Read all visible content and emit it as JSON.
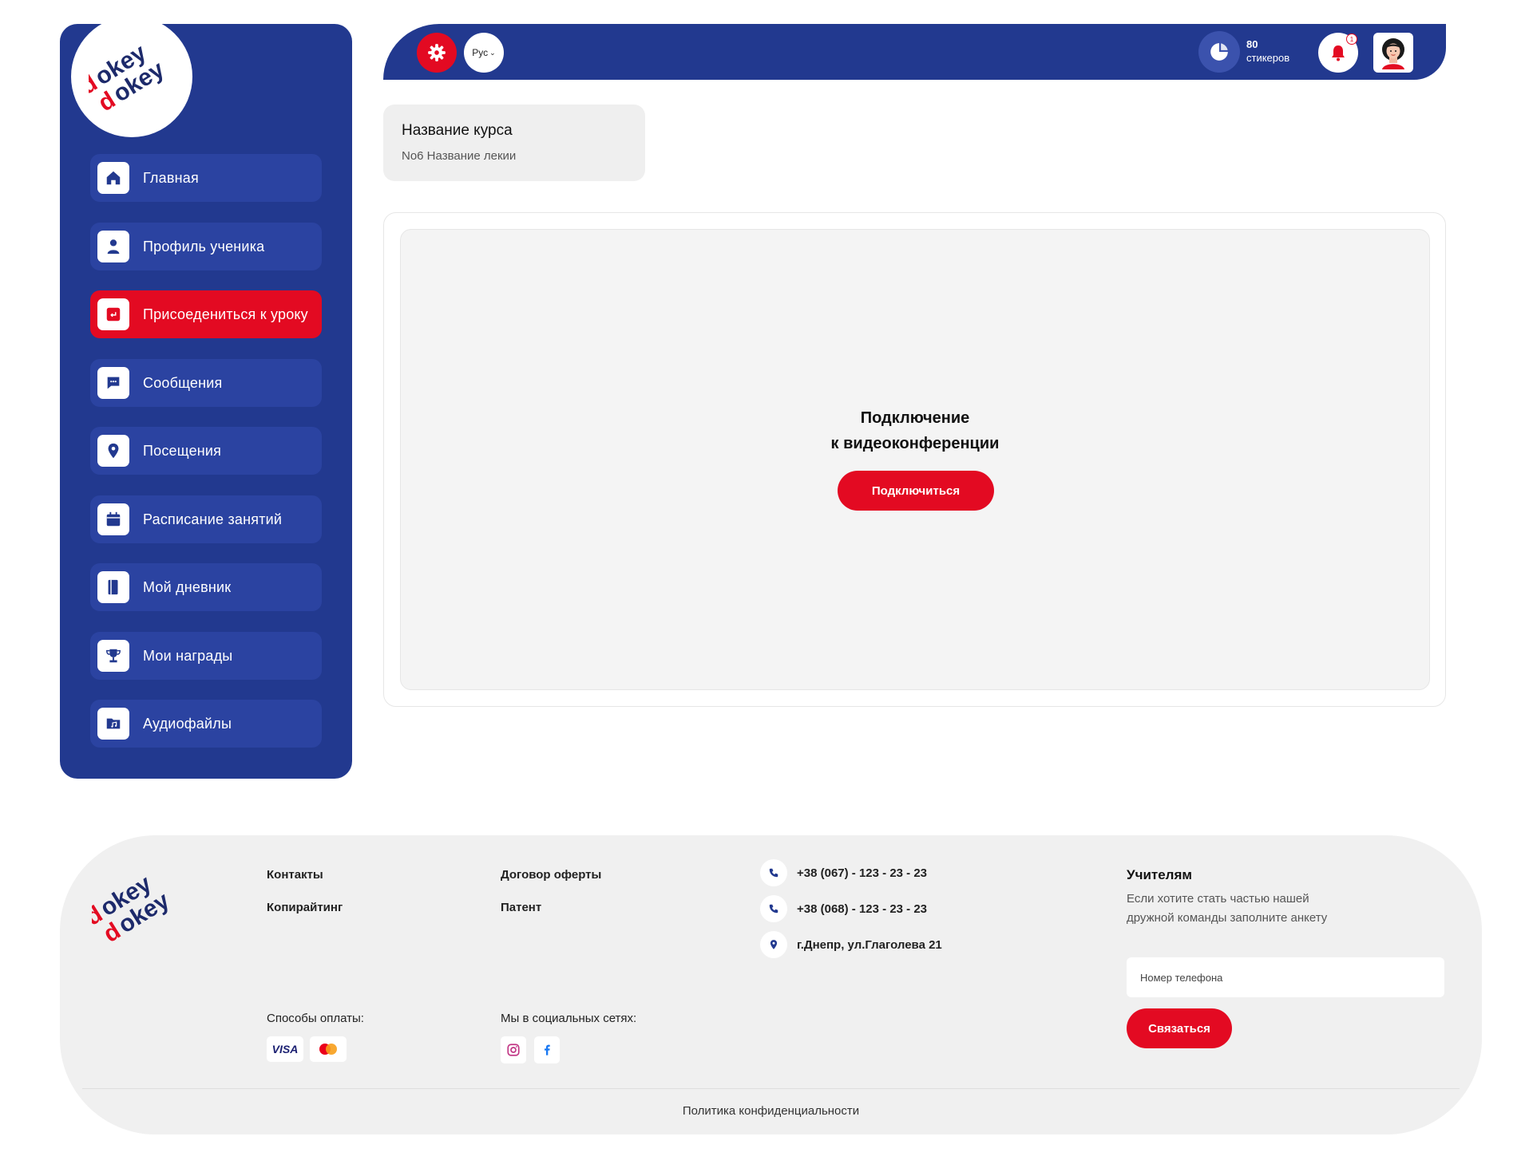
{
  "brand": {
    "logo_word_top": "okey",
    "logo_word_bottom": "okey",
    "logo_alt_letter": "d"
  },
  "sidebar": {
    "items": [
      {
        "label": "Главная",
        "icon": "home-icon",
        "active": false
      },
      {
        "label": "Профиль ученика",
        "icon": "user-icon",
        "active": false
      },
      {
        "label": "Присоедениться к уроку",
        "icon": "join-lesson-icon",
        "active": true
      },
      {
        "label": "Сообщения",
        "icon": "chat-icon",
        "active": false
      },
      {
        "label": "Посещения",
        "icon": "location-pin-icon",
        "active": false
      },
      {
        "label": "Расписание занятий",
        "icon": "calendar-icon",
        "active": false
      },
      {
        "label": "Мой дневник",
        "icon": "notebook-icon",
        "active": false
      },
      {
        "label": "Мои награды",
        "icon": "trophy-icon",
        "active": false
      },
      {
        "label": "Аудиофайлы",
        "icon": "audio-folder-icon",
        "active": false
      }
    ]
  },
  "topbar": {
    "language": "Рус",
    "stickers_count": "80",
    "stickers_label": "стикеров",
    "notifications_count": "1"
  },
  "course": {
    "title": "Название курса",
    "lecture": "No6 Название лекии"
  },
  "video": {
    "title_line1": "Подключение",
    "title_line2": "к видеоконференции",
    "button_label": "Подключиться"
  },
  "footer": {
    "links": {
      "contacts": "Контакты",
      "copyright": "Копирайтинг",
      "offer": "Договор оферты",
      "patent": "Патент"
    },
    "phone1": "+38 (067) - 123 - 23 - 23",
    "phone2": "+38 (068) - 123 - 23 - 23",
    "address": "г.Днепр, ул.Глаголева 21",
    "payment_label": "Способы оплаты:",
    "payment_methods": [
      "VISA",
      "MasterCard"
    ],
    "social_label": "Мы в социальных сетях:",
    "teachers_title": "Учителям",
    "teachers_desc": "Если хотите стать частью нашей дружной команды заполните анкету",
    "phone_placeholder": "Номер телефона",
    "contact_button": "Связаться",
    "privacy": "Политика конфиденциальности"
  },
  "colors": {
    "primary_blue": "#22398f",
    "accent_red": "#e30a22",
    "nav_item_blue": "#2b43a1",
    "footer_bg": "#f0f0f0"
  }
}
